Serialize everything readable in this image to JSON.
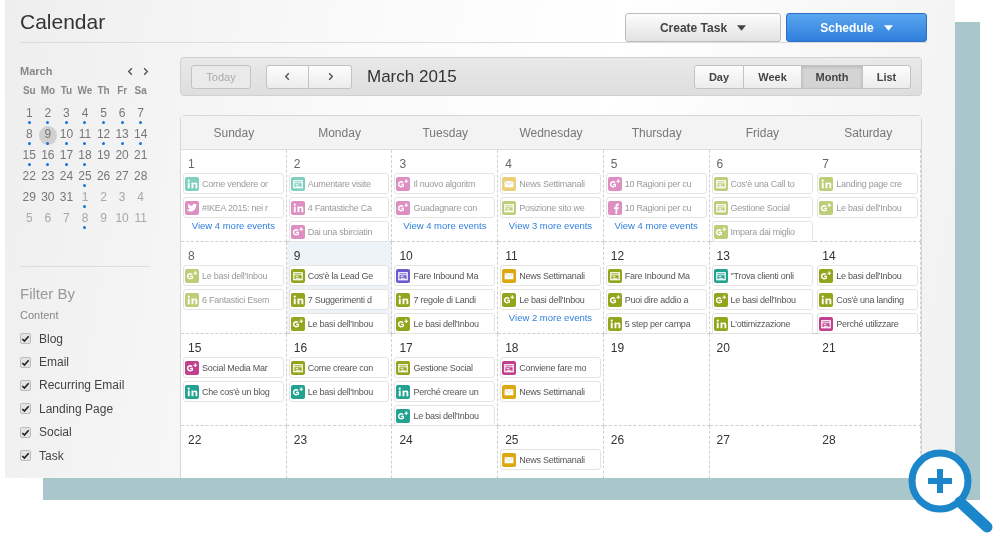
{
  "header": {
    "title": "Calendar",
    "buttons": [
      {
        "label": "Create Task",
        "kind": "default"
      },
      {
        "label": "Schedule",
        "kind": "primary"
      }
    ]
  },
  "mini_calendar": {
    "month": "March",
    "weekdays": [
      "Su",
      "Mo",
      "Tu",
      "We",
      "Th",
      "Fr",
      "Sa"
    ],
    "weeks": [
      [
        {
          "day": "1",
          "other_month": false,
          "has_events": true,
          "selected": false
        },
        {
          "day": "2",
          "other_month": false,
          "has_events": true,
          "selected": false
        },
        {
          "day": "3",
          "other_month": false,
          "has_events": true,
          "selected": false
        },
        {
          "day": "4",
          "other_month": false,
          "has_events": true,
          "selected": false
        },
        {
          "day": "5",
          "other_month": false,
          "has_events": true,
          "selected": false
        },
        {
          "day": "6",
          "other_month": false,
          "has_events": true,
          "selected": false
        },
        {
          "day": "7",
          "other_month": false,
          "has_events": true,
          "selected": false
        }
      ],
      [
        {
          "day": "8",
          "other_month": false,
          "has_events": true,
          "selected": false
        },
        {
          "day": "9",
          "other_month": false,
          "has_events": true,
          "selected": true
        },
        {
          "day": "10",
          "other_month": false,
          "has_events": true,
          "selected": false
        },
        {
          "day": "11",
          "other_month": false,
          "has_events": true,
          "selected": false
        },
        {
          "day": "12",
          "other_month": false,
          "has_events": true,
          "selected": false
        },
        {
          "day": "13",
          "other_month": false,
          "has_events": true,
          "selected": false
        },
        {
          "day": "14",
          "other_month": false,
          "has_events": true,
          "selected": false
        }
      ],
      [
        {
          "day": "15",
          "other_month": false,
          "has_events": true,
          "selected": false
        },
        {
          "day": "16",
          "other_month": false,
          "has_events": true,
          "selected": false
        },
        {
          "day": "17",
          "other_month": false,
          "has_events": true,
          "selected": false
        },
        {
          "day": "18",
          "other_month": false,
          "has_events": true,
          "selected": false
        },
        {
          "day": "19",
          "other_month": false,
          "has_events": false,
          "selected": false
        },
        {
          "day": "20",
          "other_month": false,
          "has_events": false,
          "selected": false
        },
        {
          "day": "21",
          "other_month": false,
          "has_events": false,
          "selected": false
        }
      ],
      [
        {
          "day": "22",
          "other_month": false,
          "has_events": false,
          "selected": false
        },
        {
          "day": "23",
          "other_month": false,
          "has_events": false,
          "selected": false
        },
        {
          "day": "24",
          "other_month": false,
          "has_events": false,
          "selected": false
        },
        {
          "day": "25",
          "other_month": false,
          "has_events": true,
          "selected": false
        },
        {
          "day": "26",
          "other_month": false,
          "has_events": false,
          "selected": false
        },
        {
          "day": "27",
          "other_month": false,
          "has_events": false,
          "selected": false
        },
        {
          "day": "28",
          "other_month": false,
          "has_events": false,
          "selected": false
        }
      ],
      [
        {
          "day": "29",
          "other_month": false,
          "has_events": false,
          "selected": false
        },
        {
          "day": "30",
          "other_month": false,
          "has_events": false,
          "selected": false
        },
        {
          "day": "31",
          "other_month": false,
          "has_events": false,
          "selected": false
        },
        {
          "day": "1",
          "other_month": true,
          "has_events": true,
          "selected": false
        },
        {
          "day": "2",
          "other_month": true,
          "has_events": false,
          "selected": false
        },
        {
          "day": "3",
          "other_month": true,
          "has_events": false,
          "selected": false
        },
        {
          "day": "4",
          "other_month": true,
          "has_events": false,
          "selected": false
        }
      ],
      [
        {
          "day": "5",
          "other_month": true,
          "has_events": false,
          "selected": false
        },
        {
          "day": "6",
          "other_month": true,
          "has_events": false,
          "selected": false
        },
        {
          "day": "7",
          "other_month": true,
          "has_events": false,
          "selected": false
        },
        {
          "day": "8",
          "other_month": true,
          "has_events": true,
          "selected": false
        },
        {
          "day": "9",
          "other_month": true,
          "has_events": false,
          "selected": false
        },
        {
          "day": "10",
          "other_month": true,
          "has_events": false,
          "selected": false
        },
        {
          "day": "11",
          "other_month": true,
          "has_events": false,
          "selected": false
        }
      ]
    ]
  },
  "filter": {
    "title": "Filter By",
    "section": "Content",
    "options": [
      {
        "label": "Blog",
        "checked": true
      },
      {
        "label": "Email",
        "checked": true
      },
      {
        "label": "Recurring Email",
        "checked": true
      },
      {
        "label": "Landing Page",
        "checked": true
      },
      {
        "label": "Social",
        "checked": true
      },
      {
        "label": "Task",
        "checked": true
      }
    ]
  },
  "toolbar": {
    "today": {
      "label": "Today",
      "disabled": true
    },
    "title": "March 2015",
    "views": [
      {
        "label": "Day",
        "selected": false
      },
      {
        "label": "Week",
        "selected": false
      },
      {
        "label": "Month",
        "selected": true
      },
      {
        "label": "List",
        "selected": false
      }
    ]
  },
  "month": {
    "weekdays": [
      "Sunday",
      "Monday",
      "Tuesday",
      "Wednesday",
      "Thursday",
      "Friday",
      "Saturday"
    ],
    "weeks": [
      [
        {
          "day": "1",
          "past": true,
          "today": false,
          "more": "View 4 more events",
          "events": [
            {
              "kind": "linkedin",
              "color": "#7fcfc0",
              "title": "Come vendere or"
            },
            {
              "kind": "twitter",
              "color": "#dc8fc0",
              "title": "#IKEA 2015: nei r"
            }
          ]
        },
        {
          "day": "2",
          "past": true,
          "today": false,
          "events": [
            {
              "kind": "page",
              "color": "#7fcfc0",
              "title": "Aumentare visite"
            },
            {
              "kind": "linkedin",
              "color": "#dc8fc0",
              "title": "4 Fantastiche Ca"
            },
            {
              "kind": "gplus",
              "color": "#dc8fc0",
              "title": "Dai una sbirciatin"
            }
          ]
        },
        {
          "day": "3",
          "past": true,
          "today": false,
          "more": "View 4 more events",
          "events": [
            {
              "kind": "gplus",
              "color": "#dc8fc0",
              "title": "Il nuovo algoritm"
            },
            {
              "kind": "gplus",
              "color": "#dc8fc0",
              "title": "Guadagnare con"
            }
          ]
        },
        {
          "day": "4",
          "past": true,
          "today": false,
          "more": "View 3 more events",
          "events": [
            {
              "kind": "email",
              "color": "#ecd077",
              "title": "News Settimanali"
            },
            {
              "kind": "page",
              "color": "#bccf78",
              "title": "Posizione sito we"
            }
          ]
        },
        {
          "day": "5",
          "past": true,
          "today": false,
          "more": "View 4 more events",
          "events": [
            {
              "kind": "gplus",
              "color": "#dc8fc0",
              "title": "10 Ragioni per cu"
            },
            {
              "kind": "facebook",
              "color": "#dc8fc0",
              "title": "10 Ragioni per cu"
            }
          ]
        },
        {
          "day": "6",
          "past": true,
          "today": false,
          "events": [
            {
              "kind": "page",
              "color": "#bccf78",
              "title": "Cos'è una Call to"
            },
            {
              "kind": "page",
              "color": "#bccf78",
              "title": "Gestione Social"
            },
            {
              "kind": "gplus",
              "color": "#bccf78",
              "title": "Impara dai miglio"
            }
          ]
        },
        {
          "day": "7",
          "past": true,
          "today": false,
          "events": [
            {
              "kind": "linkedin",
              "color": "#bccf78",
              "title": "Landing page cre"
            },
            {
              "kind": "gplus",
              "color": "#bccf78",
              "title": "Le basi dell'Inbou"
            }
          ]
        }
      ],
      [
        {
          "day": "8",
          "past": true,
          "today": false,
          "events": [
            {
              "kind": "gplus",
              "color": "#bccf78",
              "title": "Le basi dell'Inbou"
            },
            {
              "kind": "linkedin",
              "color": "#bccf78",
              "title": "6 Fantastici Esem"
            }
          ]
        },
        {
          "day": "9",
          "past": false,
          "today": true,
          "events": [
            {
              "kind": "page",
              "color": "#93a51c",
              "title": "Cos'è la Lead Ge"
            },
            {
              "kind": "linkedin",
              "color": "#93a51c",
              "title": "7 Suggerimenti d"
            },
            {
              "kind": "gplus",
              "color": "#93a51c",
              "title": "Le basi dell'Inbou"
            }
          ]
        },
        {
          "day": "10",
          "past": false,
          "today": false,
          "events": [
            {
              "kind": "page",
              "color": "#6a5acd",
              "title": "Fare Inbound Ma"
            },
            {
              "kind": "linkedin",
              "color": "#93a51c",
              "title": "7 regole di Landi"
            },
            {
              "kind": "gplus",
              "color": "#93a51c",
              "title": "Le basi dell'Inbou"
            }
          ]
        },
        {
          "day": "11",
          "past": false,
          "today": false,
          "more": "View 2 more events",
          "events": [
            {
              "kind": "email",
              "color": "#dba90e",
              "title": "News Settimanali"
            },
            {
              "kind": "gplus",
              "color": "#93a51c",
              "title": "Le basi dell'Inbou"
            }
          ]
        },
        {
          "day": "12",
          "past": false,
          "today": false,
          "events": [
            {
              "kind": "page",
              "color": "#93a51c",
              "title": "Fare Inbound Ma"
            },
            {
              "kind": "gplus",
              "color": "#93a51c",
              "title": "Puoi dire addio a"
            },
            {
              "kind": "linkedin",
              "color": "#93a51c",
              "title": "5 step per campa"
            }
          ]
        },
        {
          "day": "13",
          "past": false,
          "today": false,
          "events": [
            {
              "kind": "page",
              "color": "#23a291",
              "title": "\"Trova clienti onli"
            },
            {
              "kind": "gplus",
              "color": "#93a51c",
              "title": "Le basi dell'Inbou"
            },
            {
              "kind": "linkedin",
              "color": "#93a51c",
              "title": "L'ottimizzazione"
            }
          ]
        },
        {
          "day": "14",
          "past": false,
          "today": false,
          "events": [
            {
              "kind": "gplus",
              "color": "#93a51c",
              "title": "Le basi dell'Inbou"
            },
            {
              "kind": "linkedin",
              "color": "#93a51c",
              "title": "Cos'è una landing"
            },
            {
              "kind": "page",
              "color": "#c2418f",
              "title": "Perché utilizzare"
            }
          ]
        }
      ],
      [
        {
          "day": "15",
          "past": false,
          "today": false,
          "events": [
            {
              "kind": "gplus",
              "color": "#c2418f",
              "title": "Social Media Mar"
            },
            {
              "kind": "linkedin",
              "color": "#23a291",
              "title": "Che cos'è un blog"
            }
          ]
        },
        {
          "day": "16",
          "past": false,
          "today": false,
          "events": [
            {
              "kind": "page",
              "color": "#93a51c",
              "title": "Come creare con"
            },
            {
              "kind": "gplus",
              "color": "#23a291",
              "title": "Le basi dell'Inbou"
            }
          ]
        },
        {
          "day": "17",
          "past": false,
          "today": false,
          "events": [
            {
              "kind": "page",
              "color": "#93a51c",
              "title": "Gestione Social"
            },
            {
              "kind": "linkedin",
              "color": "#23a291",
              "title": "Perché creare un"
            },
            {
              "kind": "gplus",
              "color": "#23a291",
              "title": "Le basi dell'Inbou"
            }
          ]
        },
        {
          "day": "18",
          "past": false,
          "today": false,
          "events": [
            {
              "kind": "page",
              "color": "#c2418f",
              "title": "Conviene fare mo"
            },
            {
              "kind": "email",
              "color": "#dba90e",
              "title": "News Settimanali"
            }
          ]
        },
        {
          "day": "19",
          "past": false,
          "today": false
        },
        {
          "day": "20",
          "past": false,
          "today": false
        },
        {
          "day": "21",
          "past": false,
          "today": false
        }
      ],
      [
        {
          "day": "22",
          "past": false,
          "today": false
        },
        {
          "day": "23",
          "past": false,
          "today": false
        },
        {
          "day": "24",
          "past": false,
          "today": false
        },
        {
          "day": "25",
          "past": false,
          "today": false,
          "events": [
            {
              "kind": "email",
              "color": "#dba90e",
              "title": "News Settimanali"
            }
          ]
        },
        {
          "day": "26",
          "past": false,
          "today": false
        },
        {
          "day": "27",
          "past": false,
          "today": false
        },
        {
          "day": "28",
          "past": false,
          "today": false
        }
      ]
    ]
  }
}
